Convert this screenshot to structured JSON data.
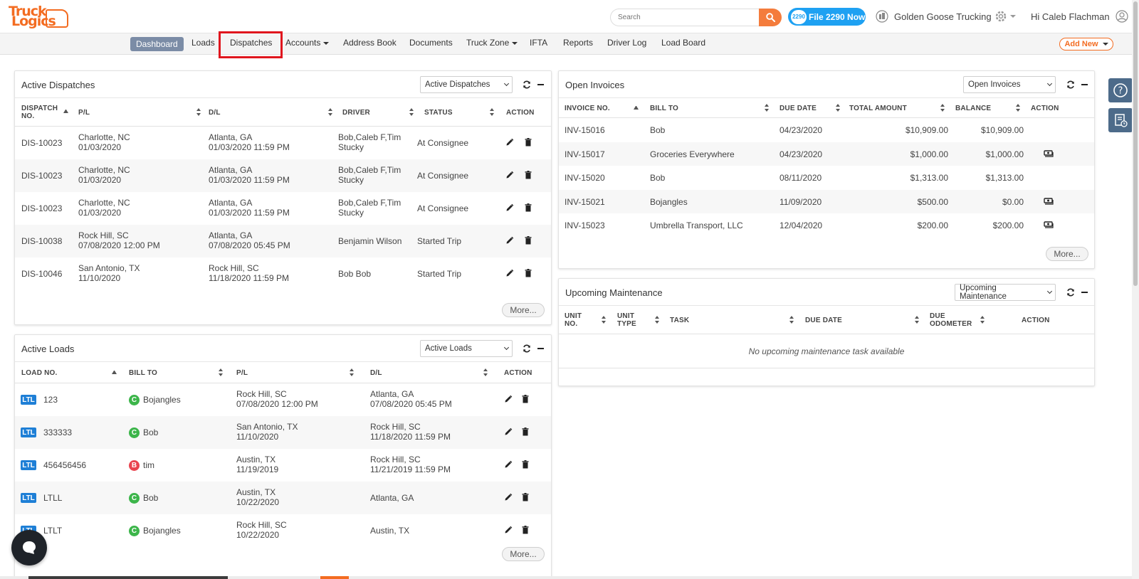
{
  "header": {
    "logo_line1": "Truck",
    "logo_line2": "Logics",
    "search_placeholder": "Search",
    "file2290_badge": "2290",
    "file2290_label": "File 2290 Now",
    "company": "Golden Goose Trucking",
    "greeting": "Hi Caleb Flachman"
  },
  "nav": {
    "items": [
      "Dashboard",
      "Loads",
      "Dispatches",
      "Accounts",
      "Address Book",
      "Documents",
      "Truck Zone",
      "IFTA",
      "Reports",
      "Driver Log",
      "Load Board"
    ],
    "add_new": "Add New"
  },
  "dispatches": {
    "title": "Active Dispatches",
    "select_value": "Active Dispatches",
    "columns": [
      "DISPATCH NO.",
      "P/L",
      "D/L",
      "DRIVER",
      "STATUS",
      "ACTION"
    ],
    "rows": [
      {
        "no": "DIS-10023",
        "pl_city": "Charlotte, NC",
        "pl_date": "01/03/2020",
        "dl_city": "Atlanta, GA",
        "dl_date": "01/03/2020 11:59 PM",
        "driver1": "Bob,Caleb F,Tim",
        "driver2": "Stucky",
        "status": "At Consignee"
      },
      {
        "no": "DIS-10023",
        "pl_city": "Charlotte, NC",
        "pl_date": "01/03/2020",
        "dl_city": "Atlanta, GA",
        "dl_date": "01/03/2020 11:59 PM",
        "driver1": "Bob,Caleb F,Tim",
        "driver2": "Stucky",
        "status": "At Consignee"
      },
      {
        "no": "DIS-10023",
        "pl_city": "Charlotte, NC",
        "pl_date": "01/03/2020",
        "dl_city": "Atlanta, GA",
        "dl_date": "01/03/2020 11:59 PM",
        "driver1": "Bob,Caleb F,Tim",
        "driver2": "Stucky",
        "status": "At Consignee"
      },
      {
        "no": "DIS-10038",
        "pl_city": "Rock Hill, SC",
        "pl_date": "07/08/2020 12:00 PM",
        "dl_city": "Atlanta, GA",
        "dl_date": "07/08/2020 05:45 PM",
        "driver1": "Benjamin Wilson",
        "driver2": "",
        "status": "Started Trip"
      },
      {
        "no": "DIS-10046",
        "pl_city": "San Antonio, TX",
        "pl_date": "11/10/2020",
        "dl_city": "Rock Hill, SC",
        "dl_date": "11/18/2020 11:59 PM",
        "driver1": "Bob Bob",
        "driver2": "",
        "status": "Started Trip"
      }
    ],
    "more": "More..."
  },
  "loads": {
    "title": "Active Loads",
    "select_value": "Active Loads",
    "columns": [
      "LOAD NO.",
      "BILL TO",
      "P/L",
      "D/L",
      "ACTION"
    ],
    "rows": [
      {
        "badge": "LTL",
        "no": "123",
        "bt_badge": "C",
        "bt_color": "#3cb54a",
        "bill_to": "Bojangles",
        "pl_city": "Rock Hill, SC",
        "pl_date": "07/08/2020 12:00 PM",
        "dl_city": "Atlanta, GA",
        "dl_date": "07/08/2020 05:45 PM"
      },
      {
        "badge": "LTL",
        "no": "333333",
        "bt_badge": "C",
        "bt_color": "#3cb54a",
        "bill_to": "Bob",
        "pl_city": "San Antonio, TX",
        "pl_date": "11/10/2020",
        "dl_city": "Rock Hill, SC",
        "dl_date": "11/18/2020 11:59 PM"
      },
      {
        "badge": "LTL",
        "no": "456456456",
        "bt_badge": "B",
        "bt_color": "#e9444f",
        "bill_to": "tim",
        "pl_city": "Austin, TX",
        "pl_date": "11/19/2019",
        "dl_city": "Rock Hill, SC",
        "dl_date": "11/21/2019 11:59 PM"
      },
      {
        "badge": "LTL",
        "no": "LTLL",
        "bt_badge": "C",
        "bt_color": "#3cb54a",
        "bill_to": "Bob",
        "pl_city": "Austin, TX",
        "pl_date": "10/22/2020",
        "dl_city": "Atlanta, GA",
        "dl_date": ""
      },
      {
        "badge": "LTL",
        "no": "LTLT",
        "bt_badge": "C",
        "bt_color": "#3cb54a",
        "bill_to": "Bojangles",
        "pl_city": "Rock Hill, SC",
        "pl_date": "10/22/2020",
        "dl_city": "Austin, TX",
        "dl_date": ""
      }
    ],
    "more": "More..."
  },
  "invoices": {
    "title": "Open Invoices",
    "select_value": "Open Invoices",
    "columns": [
      "INVOICE NO.",
      "BILL TO",
      "DUE DATE",
      "TOTAL AMOUNT",
      "BALANCE",
      "ACTION"
    ],
    "rows": [
      {
        "no": "INV-15016",
        "bill_to": "Bob",
        "due": "04/23/2020",
        "total": "$10,909.00",
        "balance": "$10,909.00",
        "action": false
      },
      {
        "no": "INV-15017",
        "bill_to": "Groceries Everywhere",
        "due": "04/23/2020",
        "total": "$1,000.00",
        "balance": "$1,000.00",
        "action": true
      },
      {
        "no": "INV-15020",
        "bill_to": "Bob",
        "due": "08/11/2020",
        "total": "$1,313.00",
        "balance": "$1,313.00",
        "action": false
      },
      {
        "no": "INV-15021",
        "bill_to": "Bojangles",
        "due": "11/09/2020",
        "total": "$500.00",
        "balance": "$0.00",
        "action": true
      },
      {
        "no": "INV-15023",
        "bill_to": "Umbrella Transport, LLC",
        "due": "12/04/2020",
        "total": "$200.00",
        "balance": "$200.00",
        "action": true
      }
    ],
    "more": "More..."
  },
  "maintenance": {
    "title": "Upcoming Maintenance",
    "select_value": "Upcoming Maintenance",
    "columns": [
      "UNIT NO.",
      "UNIT TYPE",
      "TASK",
      "DUE DATE",
      "DUE ODOMETER",
      "ACTION"
    ],
    "empty": "No upcoming maintenance task available"
  },
  "colors": {
    "brand": "#f36c21",
    "nav_active": "#7b8ca6",
    "file2290": "#1ea1f2",
    "ltl": "#1e7fd6",
    "tool": "#4d6b8a"
  }
}
